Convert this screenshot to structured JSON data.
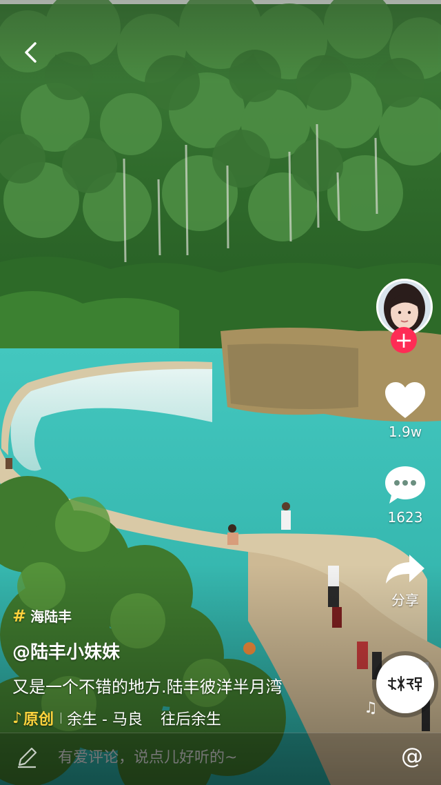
{
  "topic_tag": "海陆丰",
  "author": "@陆丰小妹妹",
  "description": "又是一个不错的地方.陆丰彼洋半月湾",
  "music": {
    "original_label": "原创",
    "song": "余生 - 马良",
    "song_2": "往后余生"
  },
  "likes": "1.9w",
  "comments": "1623",
  "share_label": "分享",
  "comment_placeholder": "有爱评论，说点儿好听的~",
  "at_symbol": "@",
  "icons": {
    "back": "chevron-left-icon",
    "like": "heart-icon",
    "comment": "speech-bubble-icon",
    "share": "share-arrow-icon",
    "follow": "plus-icon",
    "pen": "pen-icon",
    "music": "music-note-icon"
  },
  "colors": {
    "accent": "#fe2c55",
    "tag_yellow": "#ffd33d",
    "water": "#35c3ba"
  }
}
